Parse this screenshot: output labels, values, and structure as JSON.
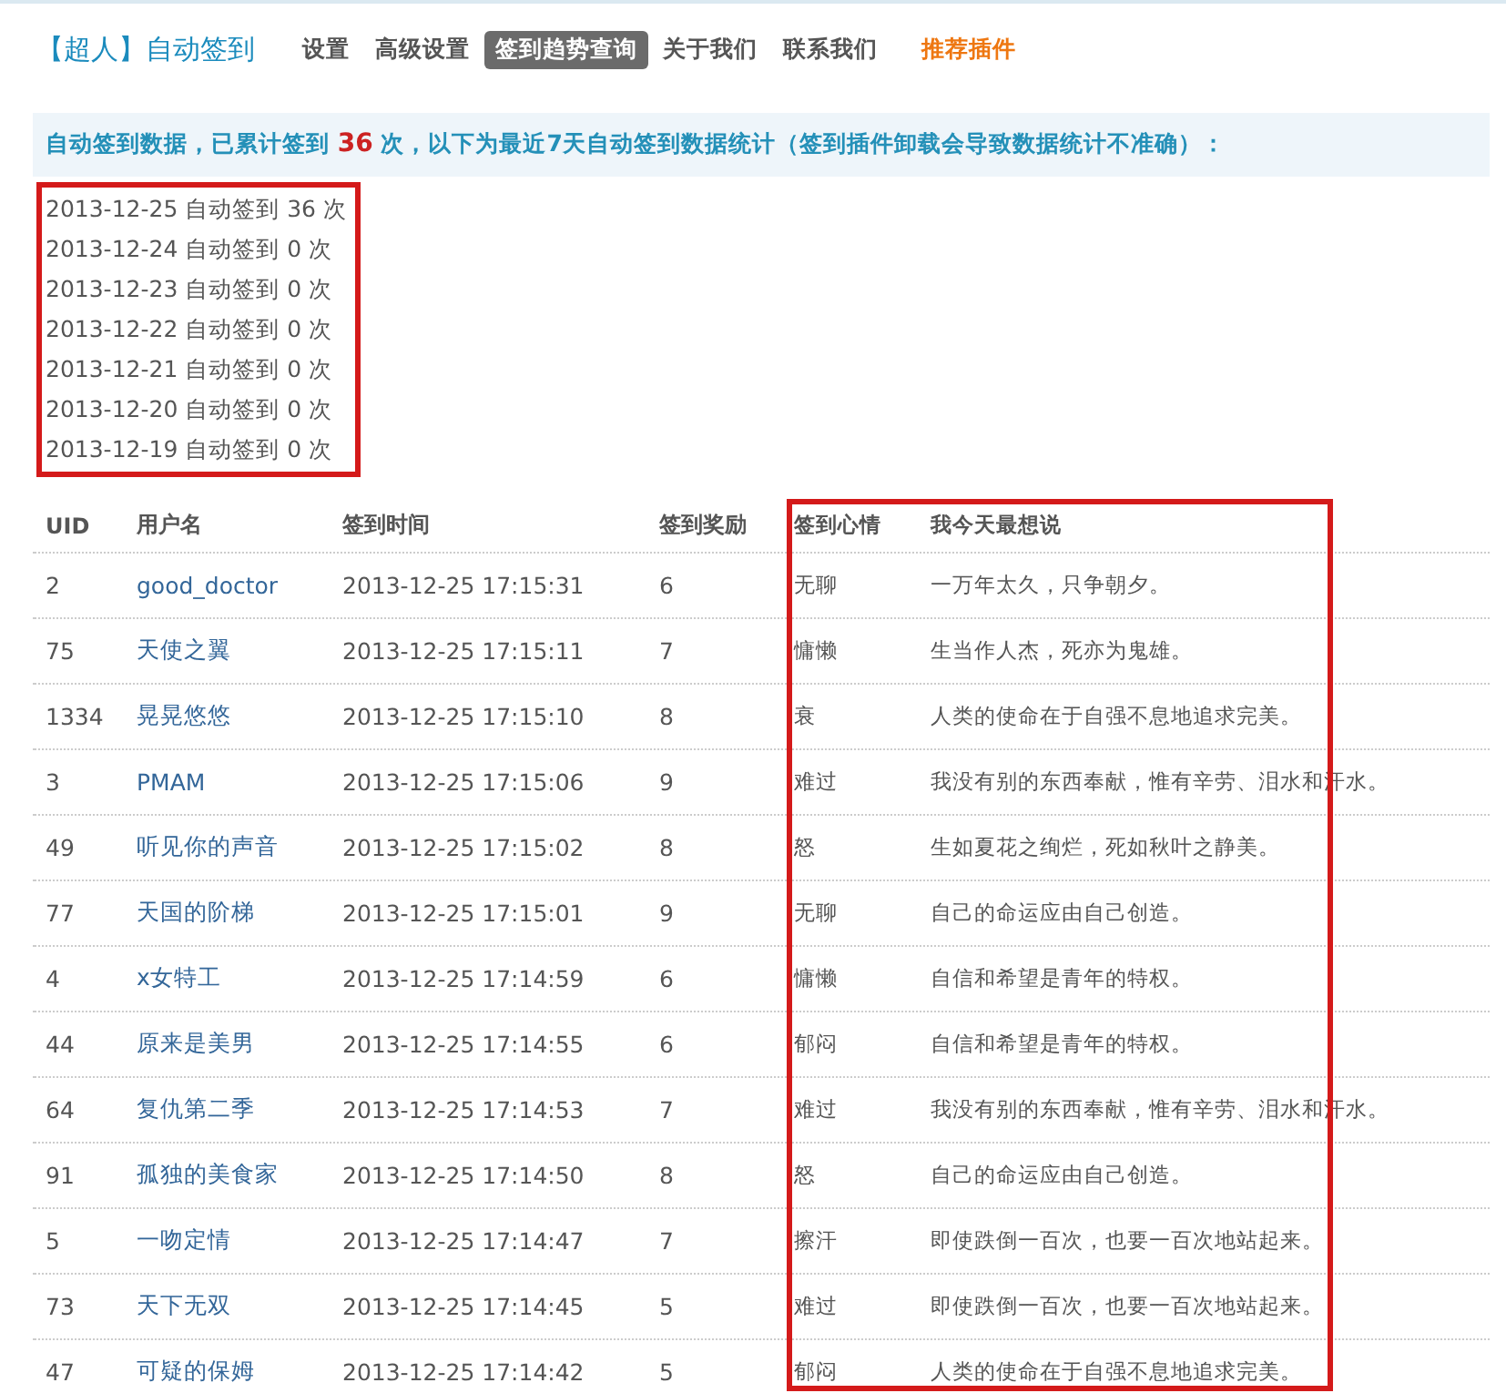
{
  "header": {
    "title": "【超人】自动签到",
    "tabs": [
      {
        "label": "设置",
        "selected": false,
        "kind": "normal"
      },
      {
        "label": "高级设置",
        "selected": false,
        "kind": "normal"
      },
      {
        "label": "签到趋势查询",
        "selected": true,
        "kind": "normal"
      },
      {
        "label": "关于我们",
        "selected": false,
        "kind": "normal"
      },
      {
        "label": "联系我们",
        "selected": false,
        "kind": "normal"
      },
      {
        "label": "推荐插件",
        "selected": false,
        "kind": "promo"
      }
    ]
  },
  "notice": {
    "before": "自动签到数据，已累计签到",
    "count": "36",
    "after": "次，以下为最近7天自动签到数据统计（签到插件卸载会导致数据统计不准确）："
  },
  "daily_stats": [
    "2013-12-25 自动签到 36 次",
    "2013-12-24 自动签到 0 次",
    "2013-12-23 自动签到 0 次",
    "2013-12-22 自动签到 0 次",
    "2013-12-21 自动签到 0 次",
    "2013-12-20 自动签到 0 次",
    "2013-12-19 自动签到 0 次"
  ],
  "table": {
    "columns": [
      "UID",
      "用户名",
      "签到时间",
      "签到奖励",
      "签到心情",
      "我今天最想说"
    ],
    "rows": [
      [
        "2",
        "good_doctor",
        "2013-12-25 17:15:31",
        "6",
        "无聊",
        "一万年太久，只争朝夕。"
      ],
      [
        "75",
        "天使之翼",
        "2013-12-25 17:15:11",
        "7",
        "慵懒",
        "生当作人杰，死亦为鬼雄。"
      ],
      [
        "1334",
        "晃晃悠悠",
        "2013-12-25 17:15:10",
        "8",
        "衰",
        "人类的使命在于自强不息地追求完美。"
      ],
      [
        "3",
        "PMAM",
        "2013-12-25 17:15:06",
        "9",
        "难过",
        "我没有别的东西奉献，惟有辛劳、泪水和汗水。"
      ],
      [
        "49",
        "听见你的声音",
        "2013-12-25 17:15:02",
        "8",
        "怒",
        "生如夏花之绚烂，死如秋叶之静美。"
      ],
      [
        "77",
        "天国的阶梯",
        "2013-12-25 17:15:01",
        "9",
        "无聊",
        "自己的命运应由自己创造。"
      ],
      [
        "4",
        "x女特工",
        "2013-12-25 17:14:59",
        "6",
        "慵懒",
        "自信和希望是青年的特权。"
      ],
      [
        "44",
        "原来是美男",
        "2013-12-25 17:14:55",
        "6",
        "郁闷",
        "自信和希望是青年的特权。"
      ],
      [
        "64",
        "复仇第二季",
        "2013-12-25 17:14:53",
        "7",
        "难过",
        "我没有别的东西奉献，惟有辛劳、泪水和汗水。"
      ],
      [
        "91",
        "孤独的美食家",
        "2013-12-25 17:14:50",
        "8",
        "怒",
        "自己的命运应由自己创造。"
      ],
      [
        "5",
        "一吻定情",
        "2013-12-25 17:14:47",
        "7",
        "擦汗",
        "即使跌倒一百次，也要一百次地站起来。"
      ],
      [
        "73",
        "天下无双",
        "2013-12-25 17:14:45",
        "5",
        "难过",
        "即使跌倒一百次，也要一百次地站起来。"
      ],
      [
        "47",
        "可疑的保姆",
        "2013-12-25 17:14:42",
        "5",
        "郁闷",
        "人类的使命在于自强不息地追求完美。"
      ]
    ]
  }
}
